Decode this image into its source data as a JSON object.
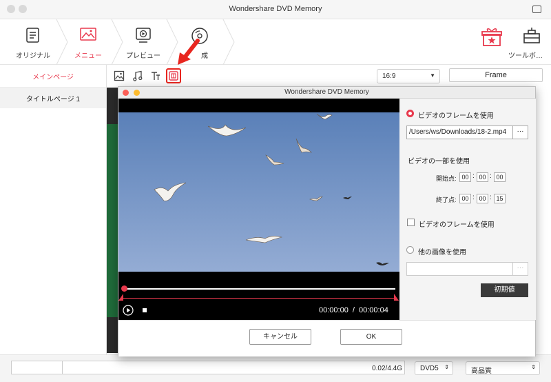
{
  "app": {
    "title": "Wondershare DVD Memory"
  },
  "steps": [
    {
      "label": "オリジナル",
      "icon": "source-icon"
    },
    {
      "label": "メニュー",
      "icon": "menu-icon",
      "active": true
    },
    {
      "label": "プレビュー",
      "icon": "preview-icon"
    },
    {
      "label": "成",
      "icon": "burn-icon"
    }
  ],
  "tools": {
    "label": "ツールボ…"
  },
  "left_panel": {
    "header": "メインページ",
    "items": [
      "タイトルページ 1"
    ]
  },
  "toolbar": {
    "aspect_ratio": "16:9",
    "frame_button": "Frame"
  },
  "dialog": {
    "title": "Wondershare DVD Memory",
    "use_frame_label": "ビデオのフレームを使用",
    "path": "/Users/ws/Downloads/18-2.mp4",
    "dots": "···",
    "part_label": "ビデオの一部を使用",
    "start_label": "開始点:",
    "end_label": "終了点:",
    "start_time": [
      "00",
      "00",
      "00"
    ],
    "end_time": [
      "00",
      "00",
      "15"
    ],
    "use_frame_checkbox_label": "ビデオのフレームを使用",
    "other_image_label": "他の画像を使用",
    "reset_label": "初期値",
    "cancel_label": "キャンセル",
    "ok_label": "OK",
    "current_time": "00:00:00",
    "time_sep": "/",
    "total_time": "00:00:04"
  },
  "bottom": {
    "size": "0.02/4.4G",
    "disc": "DVD5",
    "quality": "高品質"
  },
  "colors": {
    "accent": "#e8394d",
    "arrow": "#e8261f"
  }
}
